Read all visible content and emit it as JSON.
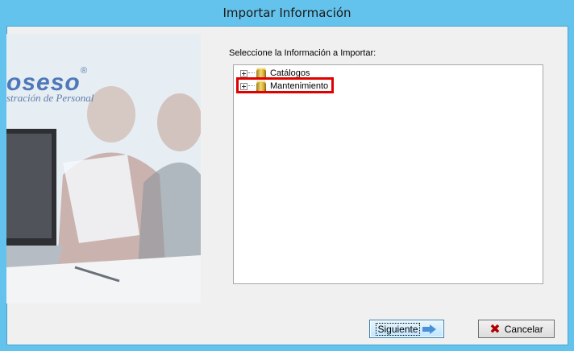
{
  "window": {
    "title": "Importar Información"
  },
  "side_image": {
    "logo_text": "oseso",
    "logo_mark": "®",
    "tagline": "stración de Personal"
  },
  "main": {
    "instruction": "Seleccione la Información a Importar:",
    "tree_items": [
      {
        "label": "Catálogos",
        "icon": "database-icon",
        "expander": "plus"
      },
      {
        "label": "Mantenimiento",
        "icon": "database-icon",
        "expander": "plus",
        "highlighted": true
      }
    ]
  },
  "buttons": {
    "next_label": "Siguiente",
    "next_icon": "arrow-right-icon",
    "cancel_label": "Cancelar",
    "cancel_icon": "x-icon"
  },
  "colors": {
    "titlebar": "#64c3ec",
    "highlight": "#e00000",
    "logo": "#4f78b8"
  }
}
